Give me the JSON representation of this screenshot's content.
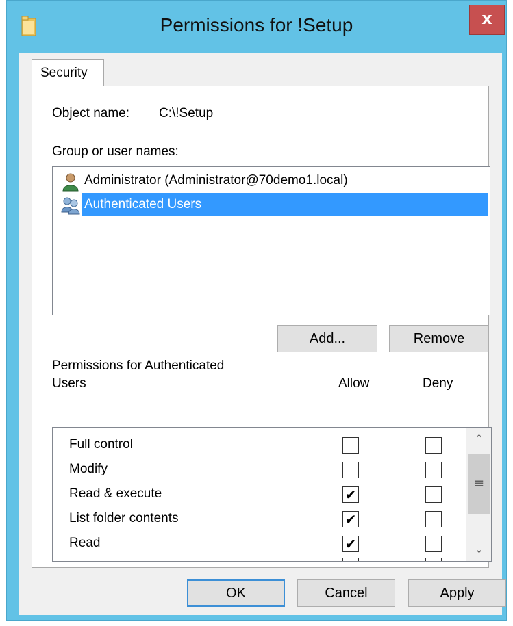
{
  "window": {
    "title": "Permissions for !Setup",
    "close_label": "x"
  },
  "tabs": [
    {
      "label": "Security"
    }
  ],
  "object_name": {
    "label": "Object name:",
    "value": "C:\\!Setup"
  },
  "group_list": {
    "label": "Group or user names:",
    "items": [
      {
        "label": "Administrator (Administrator@70demo1.local)",
        "icon": "user-icon",
        "selected": false
      },
      {
        "label": "Authenticated Users",
        "icon": "users-group-icon",
        "selected": true
      }
    ]
  },
  "buttons": {
    "add": "Add...",
    "remove": "Remove",
    "ok": "OK",
    "cancel": "Cancel",
    "apply": "Apply"
  },
  "permissions": {
    "label_line1": "Permissions for Authenticated",
    "label_line2": "Users",
    "allow_header": "Allow",
    "deny_header": "Deny",
    "rows": [
      {
        "name": "Full control",
        "allow": false,
        "deny": false
      },
      {
        "name": "Modify",
        "allow": false,
        "deny": false
      },
      {
        "name": "Read & execute",
        "allow": true,
        "deny": false
      },
      {
        "name": "List folder contents",
        "allow": true,
        "deny": false
      },
      {
        "name": "Read",
        "allow": true,
        "deny": false
      }
    ]
  },
  "colors": {
    "titlebar": "#62c2e6",
    "close": "#c75050",
    "selection": "#3399ff"
  }
}
